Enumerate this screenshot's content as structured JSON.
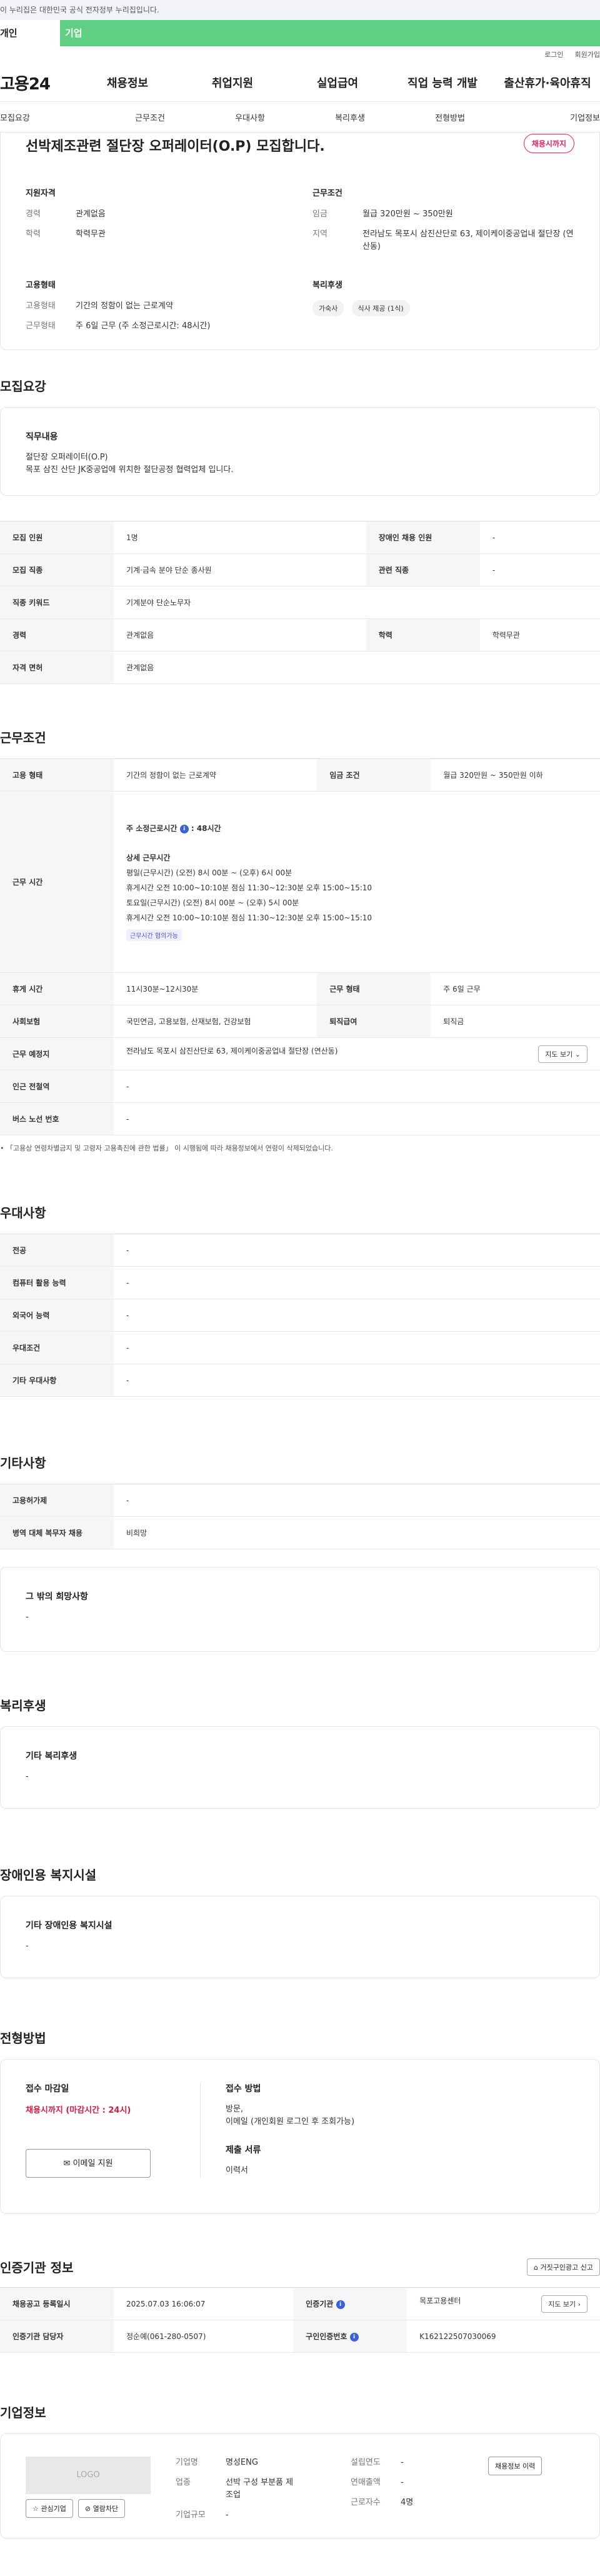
{
  "top_notice": "이 누리집은 대한민국 공식 전자정부 누리집입니다.",
  "tabs": {
    "person": "개인",
    "company": "기업"
  },
  "util": {
    "login": "로그인",
    "signup": "회원가입"
  },
  "header": {
    "logo": "고용24",
    "gnb": [
      "채용정보",
      "취업지원",
      "실업급여",
      "직업 능력 개발",
      "출산휴가·육아휴직"
    ]
  },
  "subnav": [
    "모집요강",
    "근무조건",
    "우대사항",
    "복리후생",
    "전형방법",
    "기업정보"
  ],
  "summary": {
    "title": "선박제조관련 절단장 오퍼레이터(O.P) 모집합니다.",
    "badge": "채용시까지",
    "qual_title": "지원자격",
    "qual": [
      {
        "k": "경력",
        "v": "관계없음"
      },
      {
        "k": "학력",
        "v": "학력무관"
      }
    ],
    "emp_title": "고용형태",
    "emp": [
      {
        "k": "고용형태",
        "v": "기간의 정함이 없는 근로계약"
      },
      {
        "k": "근무형태",
        "v": "주 6일 근무 (주 소정근로시간: 48시간)"
      }
    ],
    "cond_title": "근무조건",
    "cond": [
      {
        "k": "임금",
        "v": "월급 320만원 ~ 350만원"
      },
      {
        "k": "지역",
        "v": "전라남도 목포시 삼진산단로 63, 제이케이중공업내 절단장 (연산동)"
      }
    ],
    "welfare_title": "복리후생",
    "welfare_chips": [
      "가숙사",
      "식사 제공 (1식)"
    ]
  },
  "recruit": {
    "section": "모집요강",
    "job_title": "직무내용",
    "job_text_1": "절단장 오퍼레이터(O.P)",
    "job_text_2": "목포 삼진 산단 JK중공업에 위치한 절단공정 협력업체 입니다.",
    "rows": [
      [
        {
          "h": "모집 인원",
          "d": "1명"
        },
        {
          "h": "장애인 채용 인원",
          "d": "-"
        }
      ],
      [
        {
          "h": "모집 직종",
          "d": "기계·금속 분야 단순 종사원"
        },
        {
          "h": "관련 직종",
          "d": "-"
        }
      ],
      [
        {
          "h": "직종 키워드",
          "d": "기계분야 단순노무자"
        }
      ],
      [
        {
          "h": "경력",
          "d": "관계없음"
        },
        {
          "h": "학력",
          "d": "학력무관"
        }
      ],
      [
        {
          "h": "자격 면허",
          "d": "관계없음"
        }
      ]
    ]
  },
  "work": {
    "section": "근무조건",
    "emp_type_h": "고용 형태",
    "emp_type_d": "기간의 정함이 없는 근로계약",
    "wage_h": "임금 조건",
    "wage_d": "월급 320만원 ~ 350만원 이하",
    "hours_h": "근무 시간",
    "hours_week": "주 소정근로시간",
    "hours_week_val": ": 48시간",
    "hours_detail_title": "상세 근무시간",
    "hours_lines": [
      "평일(근무시간) (오전) 8시 00분 ~ (오후) 6시 00분",
      "휴게시간 오전 10:00~10:10분 점심 11:30~12:30분 오후 15:00~15:10",
      " 토요일(근무시간) (오전) 8시 00분 ~ (오후) 5시 00분",
      "휴게시간 오전 10:00~10:10분 점심 11:30~12:30분 오후 15:00~15:10"
    ],
    "hours_tag": "근무시간 협의가능",
    "rest_h": "휴게 시간",
    "rest_d": "11시30분~12시30분",
    "form_h": "근무 형태",
    "form_d": "주 6일 근무",
    "ins_h": "사회보험",
    "ins_d": "국민연금, 고용보험, 산재보험, 건강보험",
    "ret_h": "퇴직급여",
    "ret_d": "퇴직금",
    "place_h": "근무 예정지",
    "place_d": "전라남도 목포시 삼진산단로 63, 제이케이중공업내 절단장 (연산동)",
    "map_btn": "지도 보기",
    "station_h": "인근 전철역",
    "station_d": "-",
    "bus_h": "버스 노선 번호",
    "bus_d": "-",
    "note": "「고용상 연령차별금지 및 고령자 고용촉진에 관한 법률」 이 시행됨에 따라 채용정보에서 연령이 삭제되었습니다."
  },
  "pref": {
    "section": "우대사항",
    "rows": [
      {
        "h": "전공",
        "d": "-"
      },
      {
        "h": "컴퓨터 활용 능력",
        "d": "-"
      },
      {
        "h": "외국어 능력",
        "d": "-"
      },
      {
        "h": "우대조건",
        "d": "-"
      },
      {
        "h": "기타 우대사항",
        "d": "-"
      }
    ]
  },
  "etc": {
    "section": "기타사항",
    "rows": [
      {
        "h": "고용허가제",
        "d": "-"
      },
      {
        "h": "병역 대체 복무자 채용",
        "d": "비희망"
      }
    ],
    "other_title": "그 밖의 희망사항",
    "other_text": "-"
  },
  "welfare": {
    "section": "복리후생",
    "title": "기타 복리후생",
    "text": "-"
  },
  "disabled": {
    "section": "장애인용 복지시설",
    "title": "기타 장애인용 복지시설",
    "text": "-"
  },
  "process": {
    "section": "전형방법",
    "deadline_title": "접수 마감일",
    "deadline": "채용시까지 (마감시간 : 24시)",
    "email_btn": "이메일 지원",
    "method_title": "접수 방법",
    "method_1": "방문,",
    "method_2": "이메일 (개인회원 로그인 후 조회가능)",
    "docs_title": "제출 서류",
    "docs": "이력서"
  },
  "agency": {
    "section": "인증기관 정보",
    "report_btn": "거짓구인광고 신고",
    "reg_h": "채용공고 등록일시",
    "reg_d": "2025.07.03 16:06:07",
    "org_h": "인증기관",
    "org_d": "목포고용센터",
    "map_btn": "지도 보기",
    "mgr_h": "인증기관 담당자",
    "mgr_d": "정순예(061-280-0507)",
    "num_h": "구인인증번호",
    "num_d": "K162122507030069"
  },
  "company": {
    "section": "기업정보",
    "logo": "LOGO",
    "fav_btn": "관심기업",
    "block_btn": "열람차단",
    "name_k": "기업명",
    "name_v": "명성ENG",
    "ind_k": "업종",
    "ind_v": "선박 구성 부분품 제조업",
    "size_k": "기업규모",
    "size_v": "-",
    "year_k": "설립연도",
    "year_v": "-",
    "sales_k": "연매출액",
    "sales_v": "-",
    "emp_k": "근로자수",
    "emp_v": "4명",
    "info_btn": "채용정보 이력"
  }
}
